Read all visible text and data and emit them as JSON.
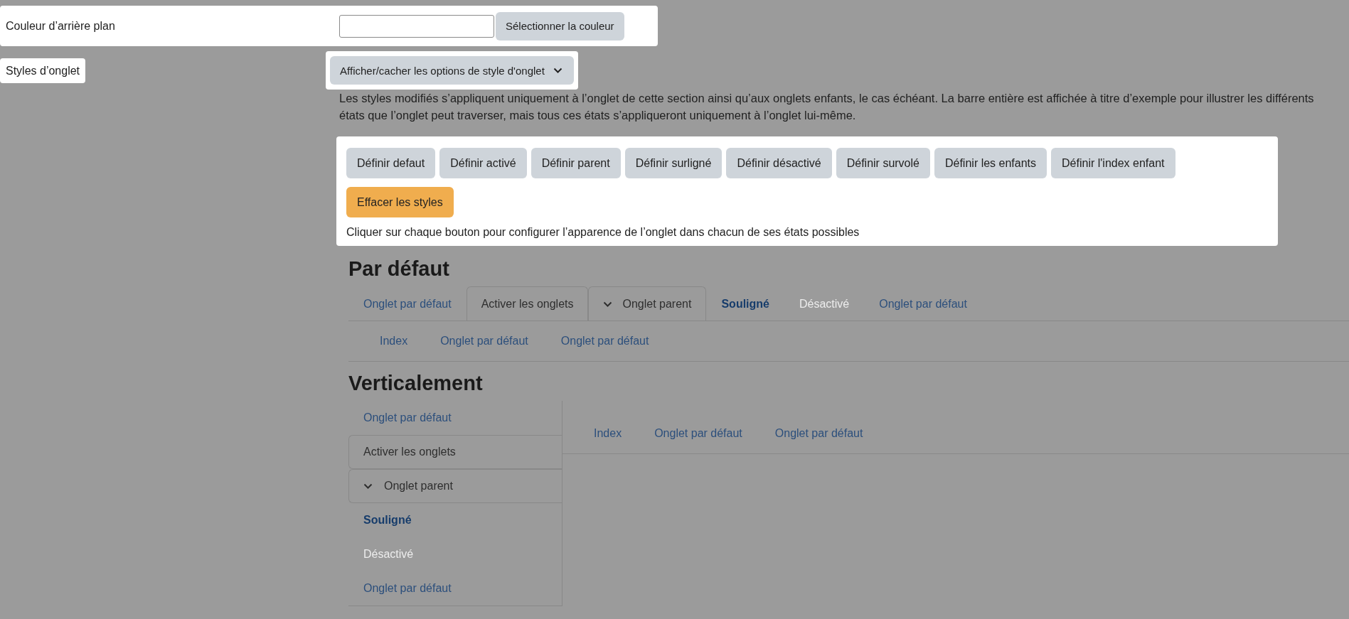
{
  "background_color": {
    "label": "Couleur d’arrière plan",
    "button": "Sélectionner la couleur"
  },
  "tab_styles": {
    "label": "Styles d’onglet",
    "toggle": "Afficher/cacher les options de style d'onglet",
    "description": "Les styles modifiés s’appliquent uniquement à l’onglet de cette section ainsi qu’aux onglets enfants, le cas échéant. La barre entière est affichée à titre d’exemple pour illustrer les différents états que l’onglet peut traverser, mais tous ces états s’appliqueront uniquement à l’onglet lui-même."
  },
  "style_buttons": [
    {
      "label": "Définir defaut",
      "kind": "set"
    },
    {
      "label": "Définir activé",
      "kind": "set"
    },
    {
      "label": "Définir parent",
      "kind": "set"
    },
    {
      "label": "Définir surligné",
      "kind": "set"
    },
    {
      "label": "Définir désactivé",
      "kind": "set"
    },
    {
      "label": "Définir survolé",
      "kind": "set"
    },
    {
      "label": "Définir les enfants",
      "kind": "set"
    },
    {
      "label": "Définir l'index enfant",
      "kind": "set"
    },
    {
      "label": "Effacer les styles",
      "kind": "clear"
    }
  ],
  "style_hint": "Cliquer sur chaque bouton pour configurer l’apparence de l’onglet dans chacun de ses états possibles",
  "horizontal": {
    "title": "Par défaut",
    "tabs": [
      {
        "label": "Onglet par défaut",
        "kind": "default"
      },
      {
        "label": "Activer les onglets",
        "kind": "active"
      },
      {
        "label": "Onglet parent",
        "kind": "parent"
      },
      {
        "label": "Souligné",
        "kind": "highlighted"
      },
      {
        "label": "Désactivé",
        "kind": "disabled"
      },
      {
        "label": "Onglet par défaut",
        "kind": "default"
      }
    ],
    "subtabs": [
      "Index",
      "Onglet par défaut",
      "Onglet par défaut"
    ]
  },
  "vertical": {
    "title": "Verticalement",
    "tabs": [
      {
        "label": "Onglet par défaut",
        "kind": "default"
      },
      {
        "label": "Activer les onglets",
        "kind": "active"
      },
      {
        "label": "Onglet parent",
        "kind": "parent"
      },
      {
        "label": "Souligné",
        "kind": "highlighted"
      },
      {
        "label": "Désactivé",
        "kind": "disabled"
      },
      {
        "label": "Onglet par défaut",
        "kind": "default"
      }
    ],
    "subtabs": [
      "Index",
      "Onglet par défaut",
      "Onglet par défaut"
    ]
  }
}
